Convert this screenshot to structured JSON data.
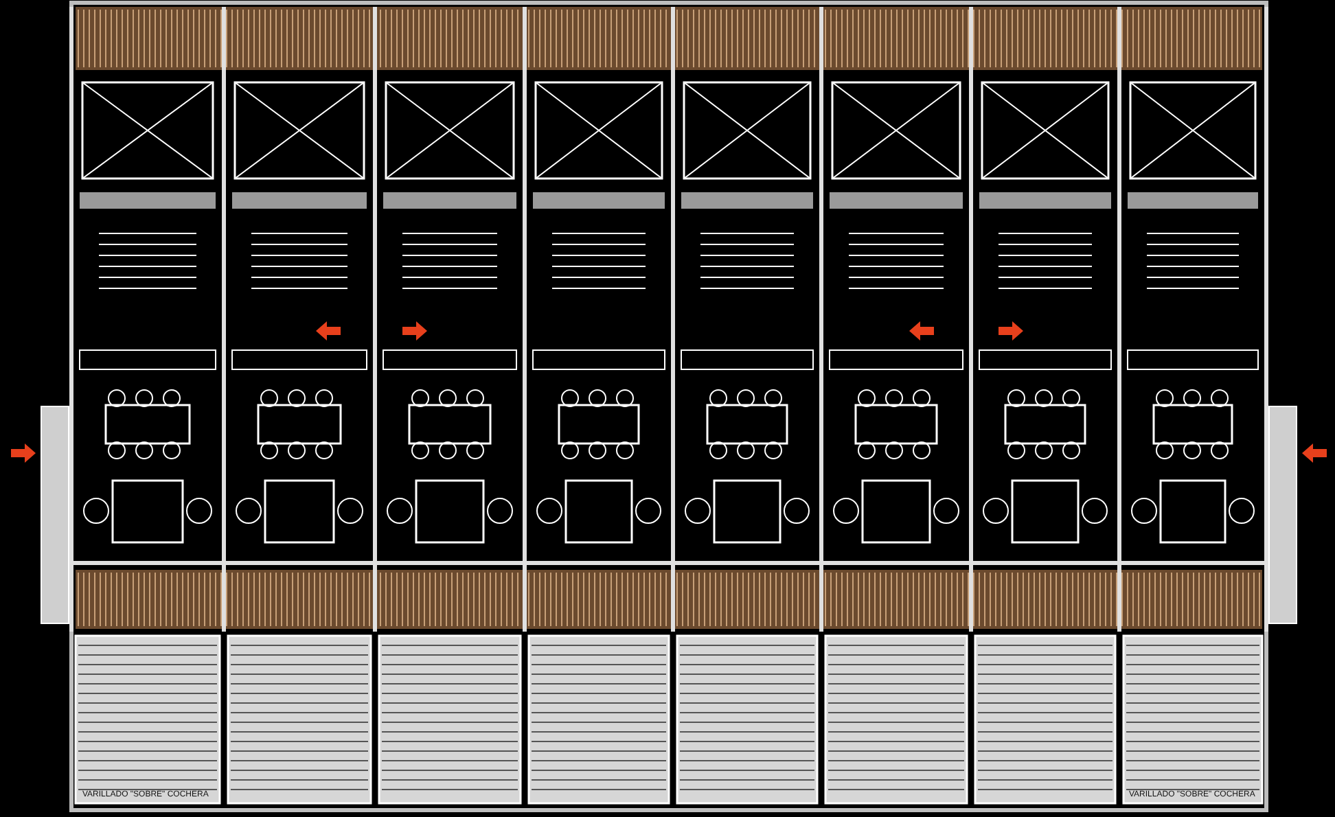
{
  "garage_labels": [
    {
      "text": "VARILLADO \"SOBRE\" COCHERA"
    },
    {
      "text": "VARILLADO \"SOBRE\" COCHERA"
    }
  ]
}
